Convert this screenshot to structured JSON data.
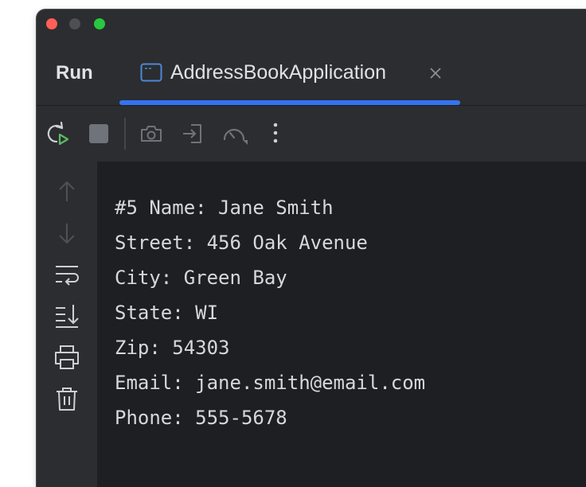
{
  "colors": {
    "window_bg": "#2b2d30",
    "console_bg": "#1e1f22",
    "text": "#dfe1e5",
    "console_text": "#d6d8dc",
    "accent": "#3574f0",
    "traffic_close": "#ff5f57",
    "traffic_min": "#4e4f53",
    "traffic_max": "#28c840",
    "icon": "#ced0d6",
    "icon_disabled": "#6f737a",
    "run_green": "#5fb865"
  },
  "tool_window": {
    "title": "Run"
  },
  "tab": {
    "title": "AddressBookApplication",
    "icon": "console-window-icon",
    "close_icon": "close-icon"
  },
  "toolbar": {
    "items": [
      {
        "icon": "rerun-icon",
        "enabled": true
      },
      {
        "icon": "stop-icon",
        "enabled": false
      },
      {
        "icon": "camera-icon",
        "enabled": false
      },
      {
        "icon": "attach-debugger-icon",
        "enabled": false
      },
      {
        "icon": "profiler-icon",
        "enabled": false
      },
      {
        "icon": "more-vertical-icon",
        "enabled": true
      }
    ]
  },
  "gutter": {
    "items": [
      {
        "icon": "arrow-up-icon",
        "enabled": false
      },
      {
        "icon": "arrow-down-icon",
        "enabled": false
      },
      {
        "icon": "soft-wrap-icon",
        "enabled": true
      },
      {
        "icon": "scroll-to-end-icon",
        "enabled": true
      },
      {
        "icon": "print-icon",
        "enabled": true
      },
      {
        "icon": "trash-icon",
        "enabled": true
      }
    ]
  },
  "console": {
    "lines": [
      "#5 Name: Jane Smith",
      "Street: 456 Oak Avenue",
      "City: Green Bay",
      "State: WI",
      "Zip: 54303",
      "Email: jane.smith@email.com",
      "Phone: 555-5678"
    ]
  }
}
